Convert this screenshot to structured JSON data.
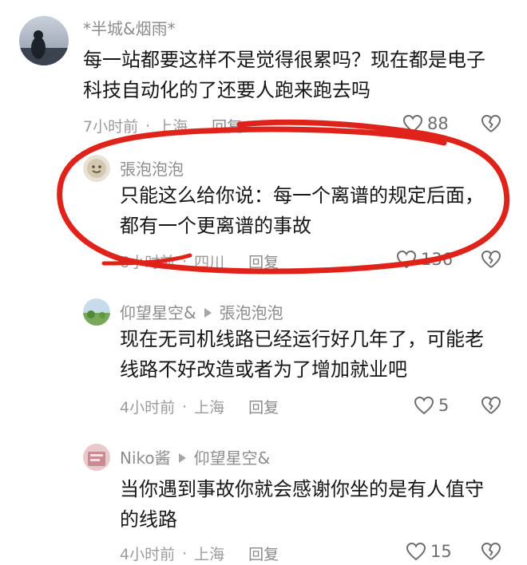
{
  "comments": [
    {
      "author": "*半城&烟雨*",
      "reply_to": null,
      "text_lines": [
        "每一站都要这样不是觉得很累吗？现在都是电子",
        "科技自动化的了还要人跑来跑去吗"
      ],
      "time": "7小时前",
      "location": "上海",
      "reply_label": "回复",
      "likes": "88",
      "icons": {
        "like": "heart-outline-icon",
        "dislike": "broken-heart-icon"
      }
    },
    {
      "author": "張泡泡泡",
      "reply_to": null,
      "text_lines": [
        "只能这么给你说：每一个离谱的规定后面，",
        "都有一个更离谱的事故"
      ],
      "time": "6小时前",
      "location": "四川",
      "reply_label": "回复",
      "likes": "136",
      "icons": {
        "like": "heart-outline-icon",
        "dislike": "broken-heart-icon"
      }
    },
    {
      "author": "仰望星空&",
      "reply_to": "張泡泡泡",
      "text_lines": [
        "现在无司机线路已经运行好几年了，可能老",
        "线路不好改造或者为了增加就业吧"
      ],
      "time": "4小时前",
      "location": "上海",
      "reply_label": "回复",
      "likes": "5",
      "icons": {
        "like": "heart-outline-icon",
        "dislike": "broken-heart-icon"
      }
    },
    {
      "author": "Niko酱",
      "reply_to": "仰望星空&",
      "text_lines": [
        "当你遇到事故你就会感谢你坐的是有人值守",
        "的线路"
      ],
      "time": "4小时前",
      "location": "上海",
      "reply_label": "回复",
      "likes": "15",
      "icons": {
        "like": "heart-outline-icon",
        "dislike": "broken-heart-icon"
      }
    }
  ],
  "separator": "·",
  "colors": {
    "highlight_ring": "#e0231a",
    "meta_gray": "#9b9b9b",
    "author_gray": "#8c8c8c",
    "text": "#161616"
  }
}
